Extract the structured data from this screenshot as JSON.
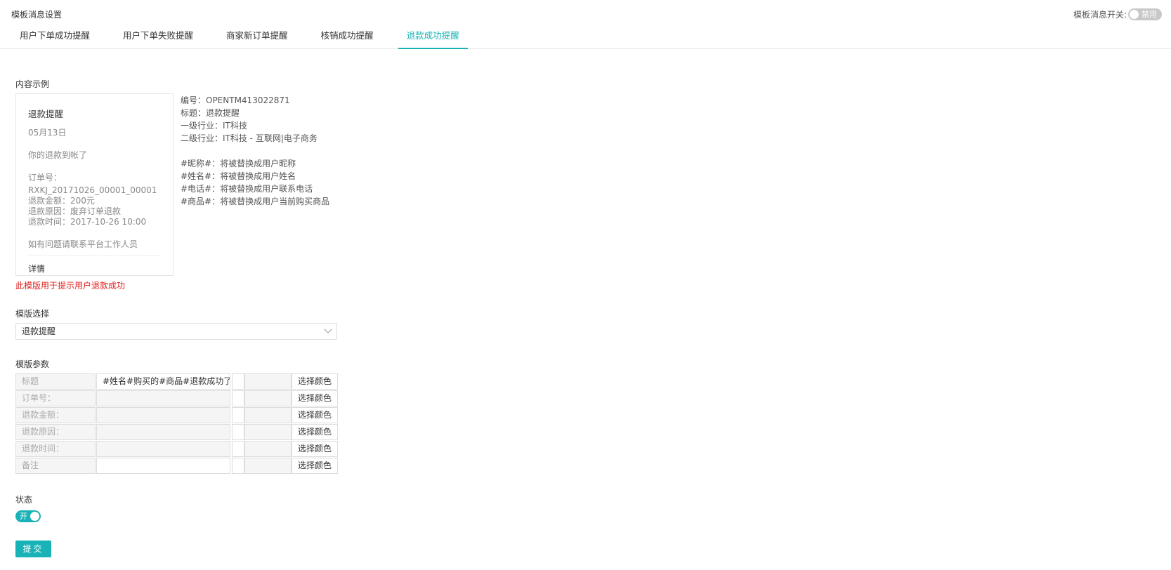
{
  "header": {
    "title": "模板消息设置",
    "master_switch_label": "模板消息开关:",
    "master_switch_state": "禁用"
  },
  "tabs": [
    {
      "label": "用户下单成功提醒"
    },
    {
      "label": "用户下单失败提醒"
    },
    {
      "label": "商家新订单提醒"
    },
    {
      "label": "核销成功提醒"
    },
    {
      "label": "退款成功提醒"
    }
  ],
  "sample": {
    "section_label": "内容示例",
    "card": {
      "title": "退款提醒",
      "date": "05月13日",
      "body": "你的退款到帐了",
      "order_label": "订单号：",
      "order_no": "RXKJ_20171026_00001_00001",
      "amount": "退款金额：200元",
      "reason": "退款原因：废弃订单退款",
      "time": "退款时间：2017-10-26 10:00",
      "note": "如有问题请联系平台工作人员",
      "detail": "详情"
    },
    "info": {
      "code": "编号：OPENTM413022871",
      "title": "标题：退款提醒",
      "industry1": "一级行业：IT科技",
      "industry2": "二级行业：IT科技 - 互联网|电子商务",
      "var_nickname": "#昵称#：将被替换成用户昵称",
      "var_name": "#姓名#：将被替换成用户姓名",
      "var_phone": "#电话#：将被替换成用户联系电话",
      "var_goods": "#商品#：将被替换成用户当前购买商品"
    },
    "hint": "此模版用于提示用户退款成功"
  },
  "template_select": {
    "label": "模版选择",
    "value": "退款提醒"
  },
  "params": {
    "label": "模版参数",
    "color_button_label": "选择颜色",
    "rows": [
      {
        "name": "标题",
        "value": "#姓名#购买的#商品#退款成功了"
      },
      {
        "name": "订单号：",
        "value": ""
      },
      {
        "name": "退款金额：",
        "value": ""
      },
      {
        "name": "退款原因：",
        "value": ""
      },
      {
        "name": "退款时间：",
        "value": ""
      },
      {
        "name": "备注",
        "value": ""
      }
    ]
  },
  "status": {
    "label": "状态",
    "toggle_label": "开"
  },
  "submit_label": "提交",
  "colors": {
    "accent": "#19b3b7",
    "hint": "#e02020"
  }
}
